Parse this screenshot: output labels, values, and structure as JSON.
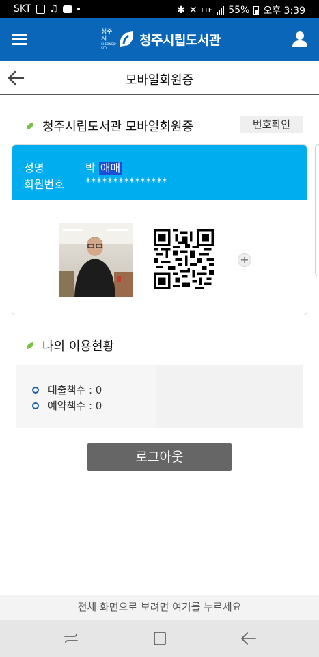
{
  "status_bar": {
    "carrier": "SKT",
    "network": "LTE",
    "battery": "55%",
    "time": "오후 3:39",
    "icons": [
      "image-icon",
      "music-icon",
      "chat-icon",
      "bluetooth-icon",
      "mute-icon",
      "signal-icon",
      "battery-icon"
    ]
  },
  "header": {
    "logo_small": "청주시",
    "logo_small_en": "CHEONGJU CITY",
    "title": "청주시립도서관",
    "icons": [
      "menu-icon",
      "user-icon"
    ]
  },
  "subheader": {
    "title": "모바일회원증"
  },
  "card_section": {
    "title": "청주시립도서관 모바일회원증",
    "verify_button": "번호확인",
    "name_label": "성명",
    "name_prefix": "박",
    "name_highlight": "애매",
    "member_no_label": "회원번호",
    "member_no": "***************"
  },
  "usage_section": {
    "title": "나의 이용현황",
    "items": [
      {
        "label": "대출책수 : 0"
      },
      {
        "label": "예약책수 : 0"
      }
    ]
  },
  "logout_button": "로그아웃",
  "fullscreen_hint": "전체 화면으로 보려면 여기를 누르세요",
  "colors": {
    "header": "#0a66b8",
    "card_top": "#00aeef",
    "leaf": "#7ac143",
    "logout": "#666666"
  }
}
